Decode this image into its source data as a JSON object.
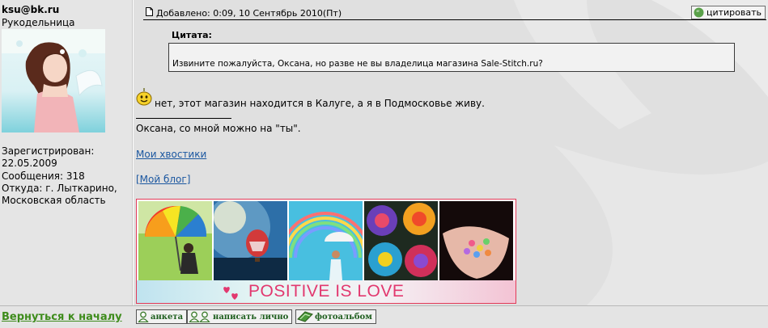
{
  "profile": {
    "username": "ksu@bk.ru",
    "rank": "Рукодельница",
    "registered_label": "Зарегистрирован:",
    "registered_date": "22.05.2009",
    "messages": "Сообщения: 318",
    "location_line1": "Откуда: г. Лыткарино,",
    "location_line2": "Московская область"
  },
  "post": {
    "posted": "Добавлено: 0:09, 10 Сентябрь 2010(Пт)",
    "quote_button": "цитировать",
    "quote_title": "Цитата:",
    "quote_text": "Извините пожалуйста, Оксана, но разве не вы владелица магазина Sale-Stitch.ru?",
    "reply_text": "нет, этот магазин находится в Калуге, а я в Подмосковье живу.",
    "signature_text": "Оксана, со мной можно на \"ты\".",
    "link_tails": "Мои хвостики",
    "link_blog": "[Мой блог]",
    "banner_text": "POSITIVE IS LOVE"
  },
  "footer": {
    "back_to_top": "Вернуться к началу",
    "btn_profile": "анкета",
    "btn_pm": "написать лично",
    "btn_album": "фотоальбом"
  },
  "colors": {
    "link": "#1b57a0",
    "back_link": "#3e8c1c",
    "banner_text": "#e2386f",
    "banner_border": "#e23a58"
  },
  "icons": [
    "page-icon",
    "quote-icon",
    "smiley-icon",
    "user-icon",
    "users-icon",
    "album-icon",
    "hearts-icon"
  ]
}
